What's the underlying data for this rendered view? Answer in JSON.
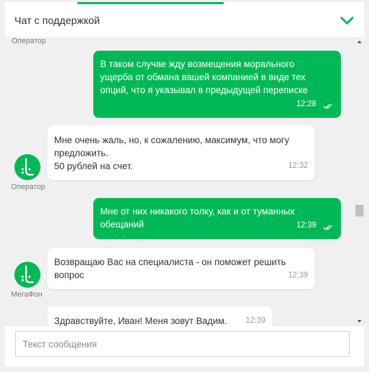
{
  "header": {
    "title": "Чат с поддержкой"
  },
  "chat": {
    "top_sender": "Оператор",
    "messages": [
      {
        "direction": "out",
        "text": "В таком случае жду возмещения морального\nущерба от обмана вашей компанией в виде тех\nопций, что я указывал в предыдущей переписке",
        "time": "12:28"
      },
      {
        "direction": "in",
        "text": "Мне очень жаль, но, к сожалению, максимум, что могу\nпредложить.\n50 рублей на счет.",
        "time": "12:32",
        "sender": "Оператор"
      },
      {
        "direction": "out",
        "text": "Мне от них никакого толку, как и от туманных\nобещаний",
        "time": "12:39"
      },
      {
        "direction": "in",
        "text": "Возвращаю Вас на специалиста - он поможет решить\nвопрос",
        "time": "12:39",
        "sender": "МегаФон"
      },
      {
        "direction": "in",
        "text": "Здравствуйте, Иван! Меня зовут Вадим.",
        "time": "12:39"
      }
    ]
  },
  "composer": {
    "placeholder": "Текст сообщения"
  },
  "colors": {
    "brand": "#00b956",
    "background": "#f0f0f0"
  }
}
